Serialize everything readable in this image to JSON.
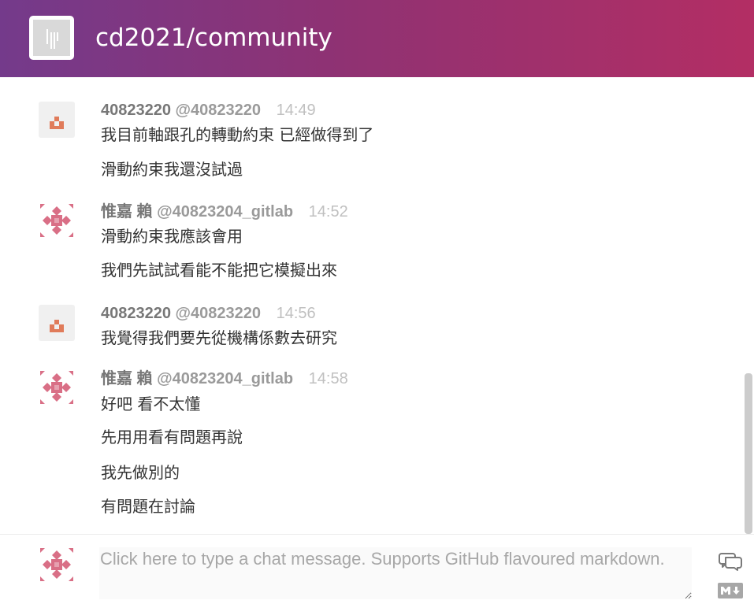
{
  "header": {
    "room_name": "cd2021/community",
    "logo_icon": "gitter-logo-icon"
  },
  "messages": [
    {
      "display_name": "40823220",
      "username": "@40823220",
      "time": "14:49",
      "lines": [
        "我目前軸跟孔的轉動約束 已經做得到了",
        "滑動約束我還沒試過"
      ]
    },
    {
      "display_name": "惟嘉 賴",
      "username": "@40823204_gitlab",
      "time": "14:52",
      "lines": [
        "滑動約束我應該會用",
        "我們先試試看能不能把它模擬出來"
      ]
    },
    {
      "display_name": "40823220",
      "username": "@40823220",
      "time": "14:56",
      "lines": [
        "我覺得我們要先從機構係數去研究"
      ]
    },
    {
      "display_name": "惟嘉 賴",
      "username": "@40823204_gitlab",
      "time": "14:58",
      "lines": [
        "好吧 看不太懂",
        "先用用看有問題再說",
        "我先做別的",
        "有問題在討論"
      ]
    }
  ],
  "composer": {
    "placeholder": "Click here to type a chat message. Supports GitHub flavoured markdown.",
    "value": "",
    "chat_icon": "chat-bubbles-icon",
    "markdown_icon": "markdown-icon"
  },
  "colors": {
    "header_start": "#743a8b",
    "header_end": "#b32e64",
    "avatar_orange": "#e07b5a",
    "avatar_pink": "#d96f86"
  }
}
